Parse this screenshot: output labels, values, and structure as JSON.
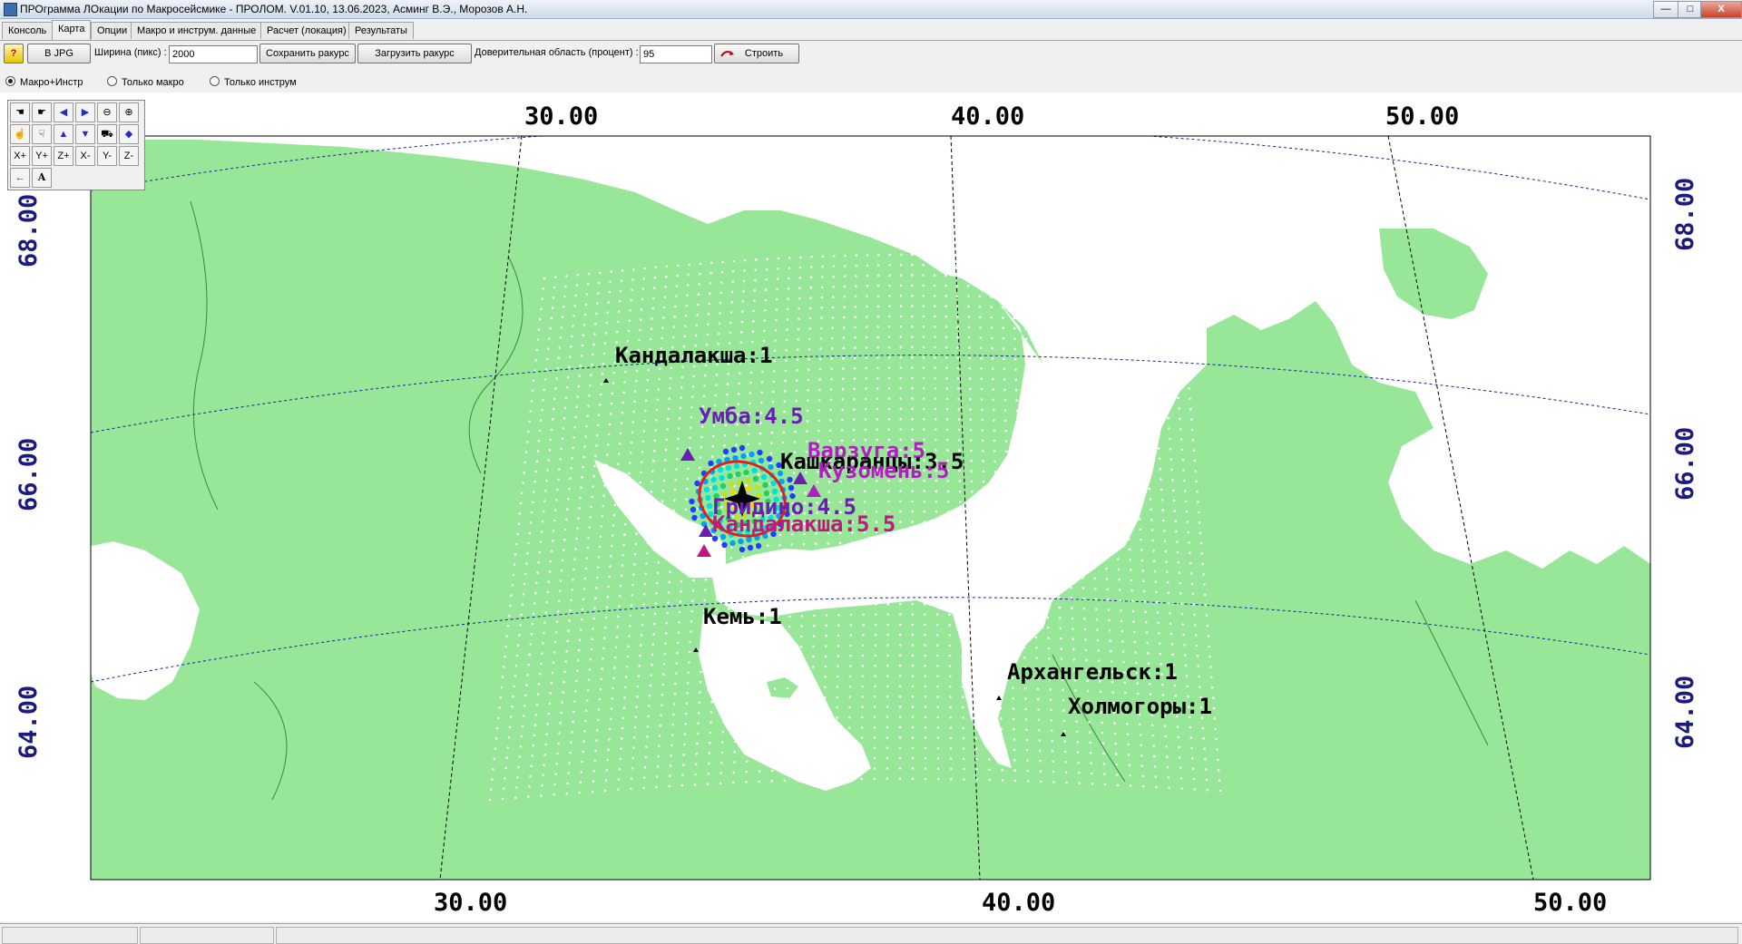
{
  "window": {
    "title": "ПРОграмма ЛОкации по Макросейсмике - ПРОЛОМ. V.01.10, 13.06.2023, Асминг В.Э., Морозов А.Н.",
    "minimize": "—",
    "maximize": "□",
    "close": "X"
  },
  "tabs": [
    "Консоль",
    "Карта",
    "Опции",
    "Макро и инструм. данные",
    "Расчет (локация)",
    "Результаты"
  ],
  "toolbar": {
    "help": "?",
    "jpg_button": "В JPG",
    "width_label": "Ширина (пикс) :",
    "width_value": "2000",
    "save_view": "Сохранить ракурс",
    "load_view": "Загрузить ракурс",
    "confidence_label": "Доверительная область (процент) :",
    "confidence_value": "95",
    "build_button": "Строить"
  },
  "mode": {
    "options": [
      "Макро+Инстр",
      "Только макро",
      "Только инструм"
    ],
    "selected": "Макро+Инстр"
  },
  "palette": [
    "X+",
    "Y+",
    "Z+",
    "X-",
    "Y-",
    "Z-",
    "A"
  ],
  "map": {
    "lon_top": [
      "30.00",
      "40.00",
      "50.00"
    ],
    "lon_bottom": [
      "30.00",
      "40.00",
      "50.00"
    ],
    "lat_left": [
      "68.00",
      "66.00",
      "64.00"
    ],
    "lat_right": [
      "68.00",
      "66.00",
      "64.00"
    ],
    "labels": [
      "Кандалакша:1",
      "Умба:4.5",
      "Варзуга:5",
      "Кашкаранцы:3.5",
      "Кузомень:5",
      "Гридино:4.5",
      "Кандалакша:5.5",
      "Кемь:1",
      "Архангельск:1",
      "Холмогоры:1"
    ],
    "colors": {
      "land": "#98e698",
      "sea": "#ffffff",
      "grid": "#1c1ca0",
      "axis": "#1a1a80",
      "ellipse": "#e02020"
    }
  },
  "status": [
    "",
    "",
    ""
  ]
}
